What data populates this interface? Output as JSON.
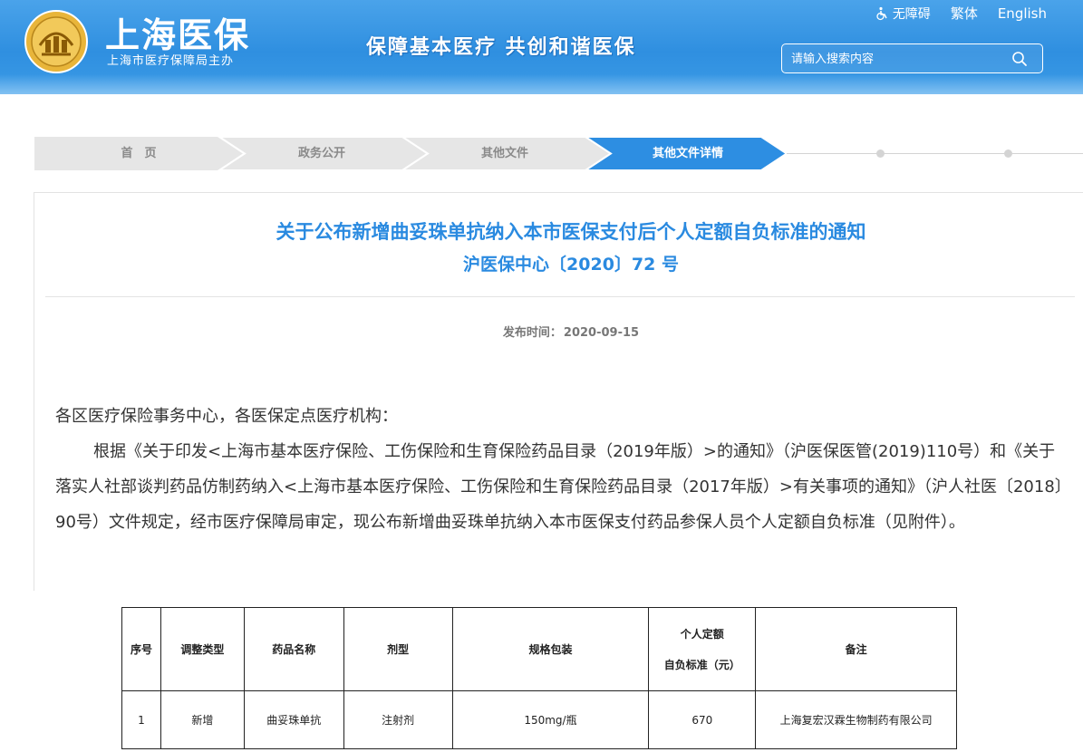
{
  "header": {
    "site_title": "上海医保",
    "site_subtitle": "上海市医疗保障局主办",
    "slogan": "保障基本医疗  共创和谐医保",
    "links": {
      "accessibility": "无障碍",
      "traditional": "繁体",
      "english": "English"
    },
    "search": {
      "placeholder": "请输入搜索内容",
      "value": ""
    },
    "colors": {
      "brand_blue": "#3194e2",
      "title_blue": "#2a8ae0",
      "crumb_active": "#2d8ee2",
      "crumb_inactive": "#e6e6e6"
    }
  },
  "breadcrumb": [
    {
      "label": "首　页"
    },
    {
      "label": "政务公开"
    },
    {
      "label": "其他文件"
    },
    {
      "label": "其他文件详情"
    }
  ],
  "article": {
    "title": "关于公布新增曲妥珠单抗纳入本市医保支付后个人定额自负标准的通知",
    "doc_number": "沪医保中心〔2020〕72 号",
    "publish_label": "发布时间：",
    "publish_date": "2020-09-15",
    "salutation": "各区医疗保险事务中心，各医保定点医疗机构：",
    "paragraph": "根据《关于印发<上海市基本医疗保险、工伤保险和生育保险药品目录（2019年版）>的通知》（沪医保医管(2019)110号）和《关于落实人社部谈判药品仿制药纳入<上海市基本医疗保险、工伤保险和生育保险药品目录（2017年版）>有关事项的通知》（沪人社医〔2018〕90号）文件规定，经市医疗保障局审定，现公布新增曲妥珠单抗纳入本市医保支付药品参保人员个人定额自负标准（见附件）。"
  },
  "table": {
    "headers": {
      "seq": "序号",
      "type": "调整类型",
      "drug": "药品名称",
      "form": "剂型",
      "spec": "规格包装",
      "std_line1": "个人定额",
      "std_line2": "自负标准（元）",
      "note": "备注"
    },
    "rows": [
      {
        "seq": "1",
        "type": "新增",
        "drug": "曲妥珠单抗",
        "form": "注射剂",
        "spec": "150mg/瓶",
        "std": "670",
        "note": "上海复宏汉霖生物制药有限公司"
      }
    ]
  }
}
